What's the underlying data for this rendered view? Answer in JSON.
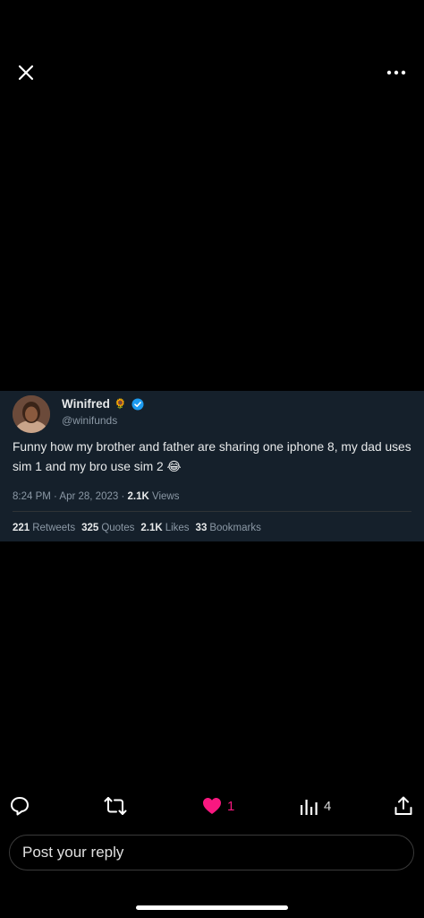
{
  "tweet": {
    "author_name": "Winifred",
    "name_emoji": "🌻",
    "handle": "@winifunds",
    "text": "Funny how my brother and father are sharing one iphone 8, my dad uses sim 1 and my bro use sim 2 😂",
    "time": "8:24 PM · Apr 28, 2023 ·",
    "views_count": "2.1K",
    "views_label": "Views",
    "stats": [
      {
        "count": "221",
        "label": "Retweets"
      },
      {
        "count": "325",
        "label": "Quotes"
      },
      {
        "count": "2.1K",
        "label": "Likes"
      },
      {
        "count": "33",
        "label": "Bookmarks"
      }
    ]
  },
  "actions": {
    "like_count": "1",
    "views_count": "4",
    "like_color": "#f91880"
  },
  "reply": {
    "placeholder": "Post your reply"
  },
  "icons": [
    "close-icon",
    "more-icon",
    "reply-icon",
    "repost-icon",
    "heart-icon",
    "views-icon",
    "share-icon",
    "verified-badge-icon"
  ]
}
